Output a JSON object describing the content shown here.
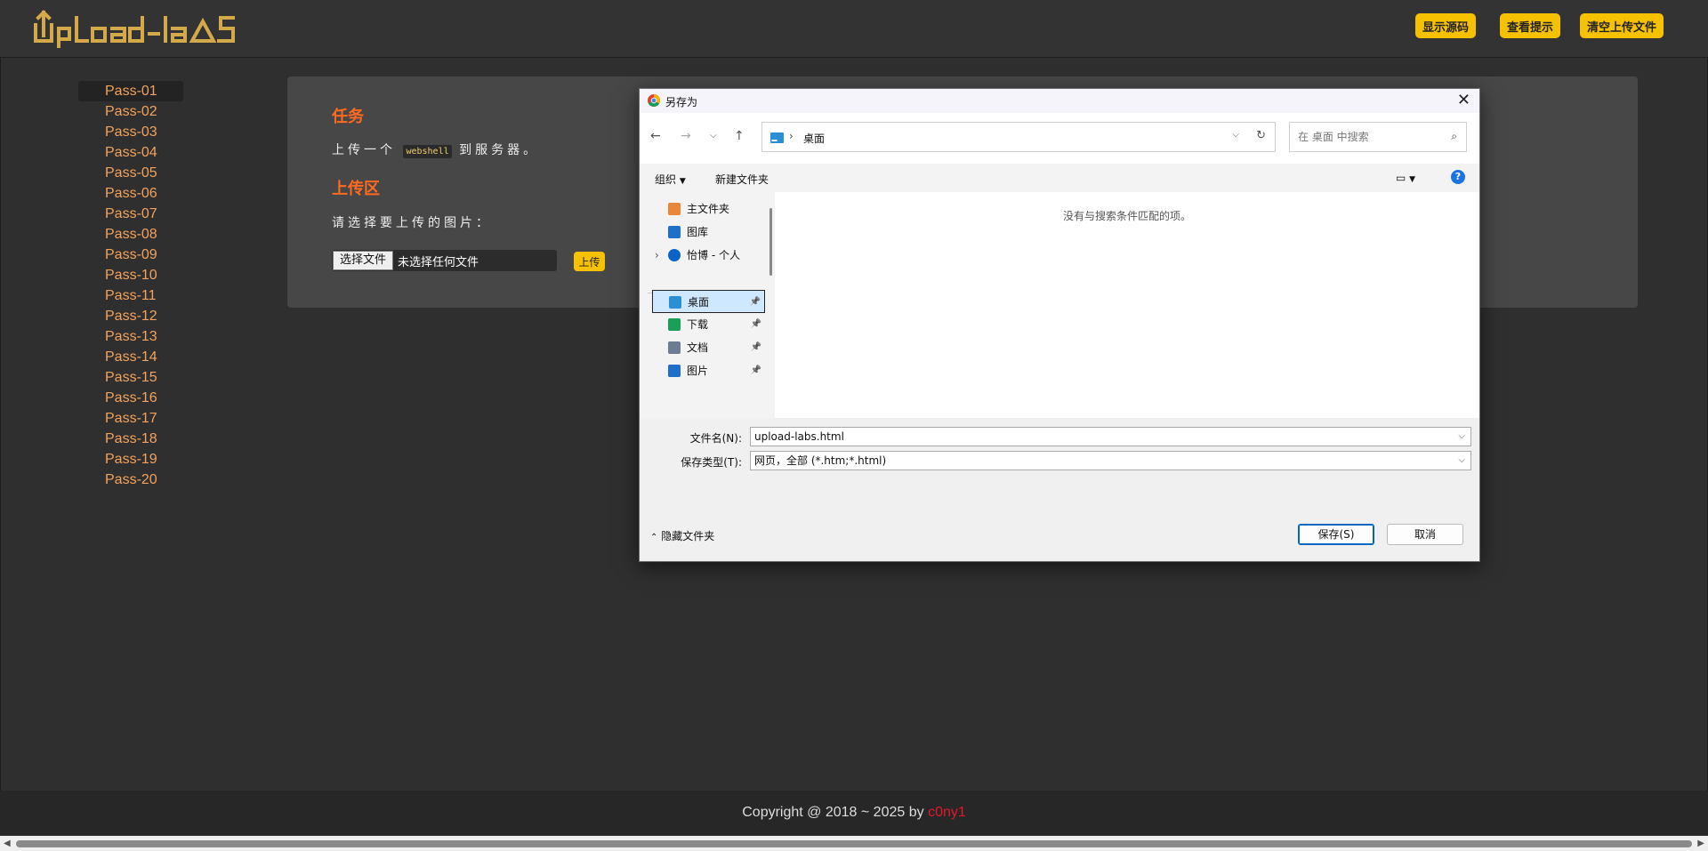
{
  "header": {
    "logo_text": "UpLoad-labS",
    "buttons": [
      "显示源码",
      "查看提示",
      "清空上传文件"
    ],
    "accent_color": "#f6c100"
  },
  "nav": {
    "active": "Pass-01",
    "items": [
      "Pass-01",
      "Pass-02",
      "Pass-03",
      "Pass-04",
      "Pass-05",
      "Pass-06",
      "Pass-07",
      "Pass-08",
      "Pass-09",
      "Pass-10",
      "Pass-11",
      "Pass-12",
      "Pass-13",
      "Pass-14",
      "Pass-15",
      "Pass-16",
      "Pass-17",
      "Pass-18",
      "Pass-19",
      "Pass-20"
    ]
  },
  "panel": {
    "task_title": "任务",
    "task_prefix": "上传一个",
    "task_code": "webshell",
    "task_suffix": "到服务器。",
    "upload_title": "上传区",
    "upload_prompt": "请选择要上传的图片：",
    "choose_file_label": "选择文件",
    "no_file_text": "未选择任何文件",
    "upload_button": "上传"
  },
  "footer": {
    "text": "Copyright @ 2018 ~ 2025 by ",
    "author": "c0ny1"
  },
  "dialog": {
    "title": "另存为",
    "address_path": "桌面",
    "search_placeholder": "在 桌面 中搜索",
    "cmd_organize": "组织",
    "cmd_new_folder": "新建文件夹",
    "tree": [
      {
        "label": "主文件夹",
        "icon": "home-icon"
      },
      {
        "label": "图库",
        "icon": "gallery-icon"
      },
      {
        "label": "怡博 - 个人",
        "icon": "onedrive-cloud-icon"
      },
      {
        "label": "桌面",
        "icon": "desktop-icon"
      },
      {
        "label": "下载",
        "icon": "download-icon"
      },
      {
        "label": "文档",
        "icon": "document-icon"
      },
      {
        "label": "图片",
        "icon": "pictures-icon"
      }
    ],
    "empty_message": "没有与搜索条件匹配的项。",
    "filename_label": "文件名(N):",
    "filename_value": "upload-labs.html",
    "filetype_label": "保存类型(T):",
    "filetype_value": "网页，全部 (*.htm;*.html)",
    "hide_folders": "隐藏文件夹",
    "save_button": "保存(S)",
    "cancel_button": "取消"
  }
}
